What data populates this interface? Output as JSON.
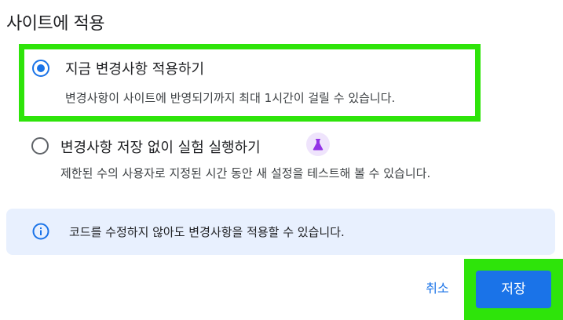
{
  "title": "사이트에 적용",
  "options": [
    {
      "label": "지금 변경사항 적용하기",
      "description": "변경사항이 사이트에 반영되기까지 최대 1시간이 걸릴 수 있습니다.",
      "selected": true
    },
    {
      "label": "변경사항 저장 없이 실험 실행하기",
      "description": "제한된 수의 사용자로 지정된 시간 동안 새 설정을 테스트해 볼 수 있습니다.",
      "selected": false,
      "badge_icon": "flask-icon"
    }
  ],
  "info": {
    "icon": "info-icon",
    "text": "코드를 수정하지 않아도 변경사항을 적용할 수 있습니다."
  },
  "actions": {
    "cancel_label": "취소",
    "save_label": "저장"
  },
  "colors": {
    "accent": "#1a73e8",
    "highlight": "#2ee40a",
    "info_bg": "#e8f0fe",
    "flask_bg": "#efe4fc",
    "flask": "#9334e6"
  }
}
